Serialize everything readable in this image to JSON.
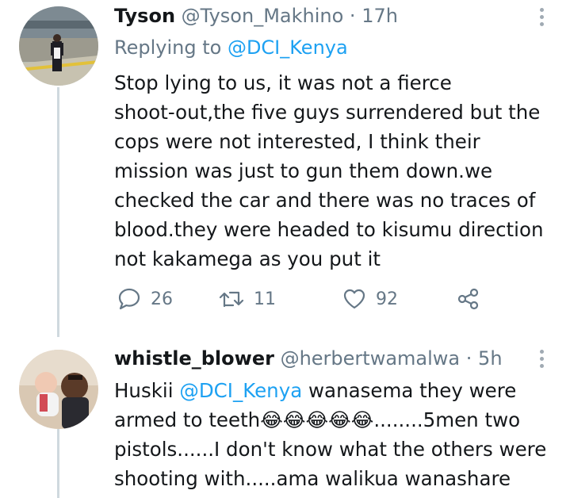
{
  "tweets": [
    {
      "name": "Tyson",
      "handle": "@Tyson_Makhino",
      "separator": "·",
      "time": "17h",
      "replying_prefix": "Replying to ",
      "replying_to": "@DCI_Kenya",
      "text": "Stop lying to us, it was not a fierce\nshoot-out,the five guys surrendered but the\ncops were not interested, I think their\nmission was just to gun them down.we\nchecked the car and there was no traces of\nblood.they were headed to kisumu direction\nnot kakamega as you put it",
      "replies": "26",
      "retweets": "11",
      "likes": "92"
    },
    {
      "name": "whistle_blower",
      "handle": "@herbertwamalwa",
      "separator": "·",
      "time": "5h",
      "text_prefix": "Huskii ",
      "mention": "@DCI_Kenya",
      "text_suffix": " wanasema they were\narmed to teeth😂😂😂😂😂........5men two\npistols......I don't know what the others were\nshooting  with.....ama walikua wanashare"
    }
  ],
  "colors": {
    "accent": "#1da1f2",
    "muted": "#657786",
    "text": "#14171a",
    "thread_line": "#cfd9de"
  },
  "icons": {
    "reply": "speech-bubble-icon",
    "retweet": "retweet-icon",
    "like": "heart-icon",
    "share": "share-icon",
    "more": "vertical-dots-icon"
  }
}
